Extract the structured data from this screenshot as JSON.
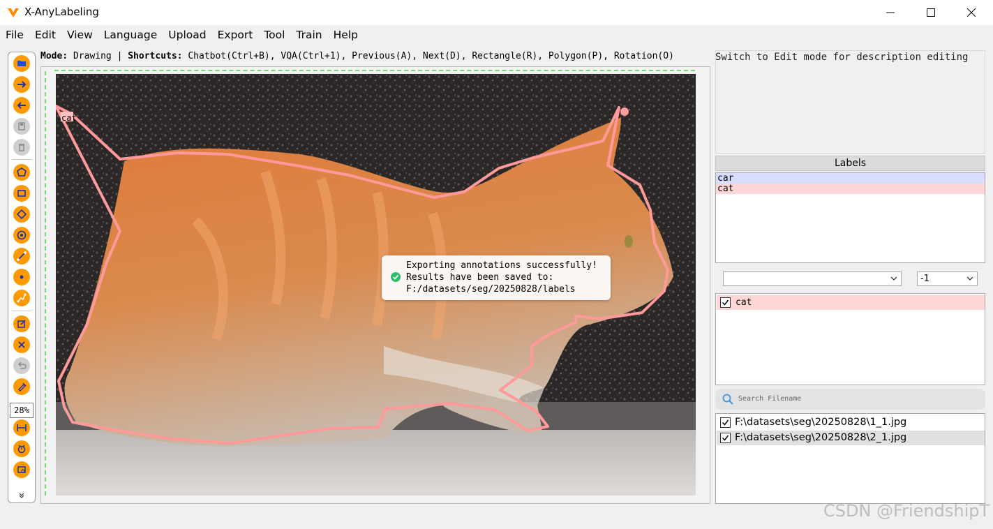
{
  "window": {
    "title": "X-AnyLabeling",
    "controls": [
      "minimize",
      "maximize",
      "close"
    ]
  },
  "menu": [
    "File",
    "Edit",
    "View",
    "Language",
    "Upload",
    "Export",
    "Tool",
    "Train",
    "Help"
  ],
  "toolbar": {
    "zoom": "28%",
    "more": "»",
    "tools": [
      "open-dir-icon",
      "next-image-icon",
      "prev-image-icon",
      "save-icon",
      "delete-icon",
      "polygon-icon",
      "rectangle-icon",
      "rotation-icon",
      "circle-icon",
      "line-icon",
      "point-icon",
      "linestrip-icon",
      "edit-icon",
      "delete-shape-icon",
      "undo-icon",
      "brush-icon",
      "fit-width-icon",
      "auto-label-icon",
      "image-info-icon"
    ]
  },
  "modeline": {
    "mode_key": "Mode:",
    "mode_value": " Drawing | ",
    "shortcuts_key": "Shortcuts:",
    "shortcuts_text": " Chatbot(Ctrl+B), VQA(Ctrl+1), Previous(A), Next(D), Rectangle(R), Polygon(P), Rotation(O)"
  },
  "canvas": {
    "shape_label": "cat"
  },
  "toast": {
    "line1": "Exporting annotations successfully!",
    "line2": "Results have been saved to:",
    "line3": "F:/datasets/seg/20250828/labels"
  },
  "description": {
    "placeholder": "Switch to Edit mode for description editing"
  },
  "labels_panel": {
    "header": "Labels",
    "items": [
      "car",
      "cat"
    ],
    "colors": {
      "car": "#d8dcff",
      "cat": "#ffd6d6"
    }
  },
  "combos": {
    "label_value": "",
    "group_value": "-1"
  },
  "shapes": [
    {
      "label": "cat",
      "checked": true
    }
  ],
  "file_search": {
    "placeholder": "Search Filename"
  },
  "files": [
    {
      "name": "F:\\datasets\\seg\\20250828\\1_1.jpg",
      "checked": true
    },
    {
      "name": "F:\\datasets\\seg\\20250828\\2_1.jpg",
      "checked": true
    }
  ],
  "watermark": "CSDN @FriendshipT",
  "colors": {
    "accent": "#ff9900",
    "polygon": "#ff9a9a",
    "success": "#2ebd6b"
  }
}
